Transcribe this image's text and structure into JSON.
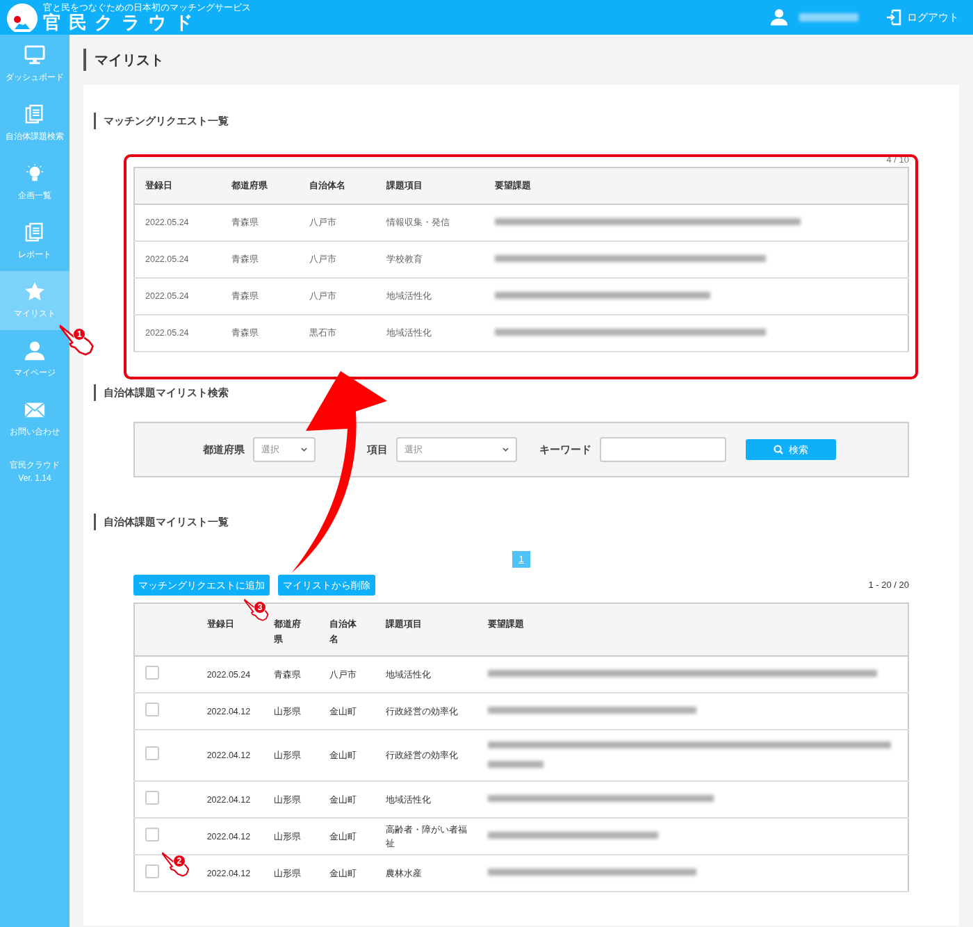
{
  "header": {
    "tagline": "官と民をつなぐための日本初のマッチングサービス",
    "brand": "官 民 ク ラ ウ ド",
    "user_blurred": true,
    "logout": "ログアウト"
  },
  "sidebar": {
    "items": [
      {
        "label": "ダッシュボード",
        "kind": "monitor",
        "selected": false
      },
      {
        "label": "自治体課題検索",
        "kind": "document",
        "selected": false
      },
      {
        "label": "企画一覧",
        "kind": "bulb",
        "selected": false
      },
      {
        "label": "レポート",
        "kind": "document",
        "selected": false
      },
      {
        "label": "マイリスト",
        "kind": "star",
        "selected": true
      },
      {
        "label": "マイページ",
        "kind": "person",
        "selected": false
      },
      {
        "label": "お問い合わせ",
        "kind": "mail",
        "selected": false
      }
    ],
    "footer": [
      "官民クラウド",
      "Ver. 1.14"
    ]
  },
  "page_title": "マイリスト",
  "requests": {
    "heading": "マッチングリクエスト一覧",
    "count": "4 / 10",
    "columns": [
      "登録日",
      "都道府県",
      "自治体名",
      "課題項目",
      "要望課題"
    ],
    "rows": [
      {
        "date": "2022.05.24",
        "prefecture": "青森県",
        "municipality": "八戸市",
        "topic": "情報収集・発信",
        "request_blurred": true
      },
      {
        "date": "2022.05.24",
        "prefecture": "青森県",
        "municipality": "八戸市",
        "topic": "学校教育",
        "request_blurred": true
      },
      {
        "date": "2022.05.24",
        "prefecture": "青森県",
        "municipality": "八戸市",
        "topic": "地域活性化",
        "request_blurred": true
      },
      {
        "date": "2022.05.24",
        "prefecture": "青森県",
        "municipality": "黒石市",
        "topic": "地域活性化",
        "request_blurred": true
      }
    ]
  },
  "search": {
    "heading": "自治体課題マイリスト検索",
    "fields": [
      {
        "kind": "select",
        "label": "都道府県",
        "value": "選択"
      },
      {
        "kind": "select",
        "label": "項目",
        "value": "選択"
      },
      {
        "kind": "text",
        "label": "キーワード"
      }
    ],
    "button": "検索"
  },
  "mylist": {
    "heading": "自治体課題マイリスト一覧",
    "pages": [
      {
        "label": "1",
        "selected": true
      }
    ],
    "buttons": [
      "マッチングリクエストに追加",
      "マイリストから削除"
    ],
    "count": "1 - 20 / 20",
    "columns": [
      "",
      "登録日",
      "都道府県",
      "自治体名",
      "課題項目",
      "要望課題"
    ],
    "rows": [
      {
        "checked": false,
        "date": "2022.05.24",
        "prefecture": "青森県",
        "municipality": "八戸市",
        "topic": "地域活性化",
        "request_blurred": true,
        "request_wraps": false
      },
      {
        "checked": false,
        "date": "2022.04.12",
        "prefecture": "山形県",
        "municipality": "金山町",
        "topic": "行政経営の効率化",
        "request_blurred": true,
        "request_wraps": false
      },
      {
        "checked": false,
        "date": "2022.04.12",
        "prefecture": "山形県",
        "municipality": "金山町",
        "topic": "行政経営の効率化",
        "request_blurred": true,
        "request_wraps": true
      },
      {
        "checked": false,
        "date": "2022.04.12",
        "prefecture": "山形県",
        "municipality": "金山町",
        "topic": "地域活性化",
        "request_blurred": true,
        "request_wraps": false
      },
      {
        "checked": false,
        "date": "2022.04.12",
        "prefecture": "山形県",
        "municipality": "金山町",
        "topic": "高齢者・障がい者福祉",
        "request_blurred": true,
        "request_wraps": false
      },
      {
        "checked": false,
        "date": "2022.04.12",
        "prefecture": "山形県",
        "municipality": "金山町",
        "topic": "農林水産",
        "request_blurred": true,
        "request_wraps": false
      }
    ]
  },
  "annotations": [
    {
      "kind": "frame"
    },
    {
      "kind": "arrow"
    },
    {
      "kind": "pointer",
      "number": "1"
    },
    {
      "kind": "pointer",
      "number": "2"
    },
    {
      "kind": "pointer",
      "number": "3"
    }
  ]
}
